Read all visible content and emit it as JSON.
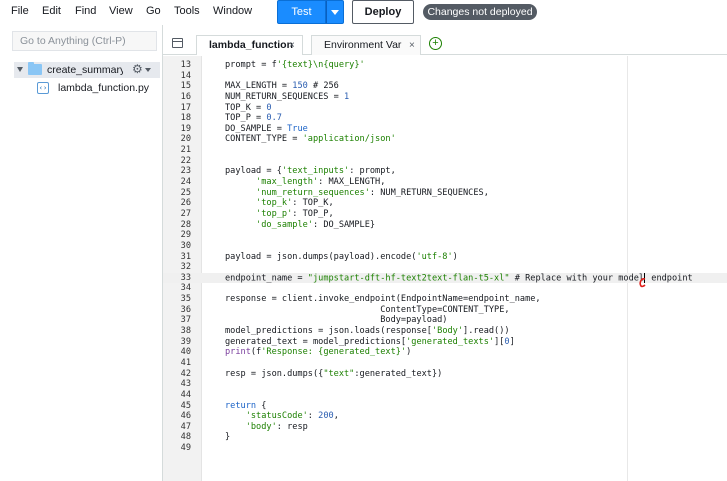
{
  "menubar": {
    "items": [
      "File",
      "Edit",
      "Find",
      "View",
      "Go",
      "Tools",
      "Window"
    ],
    "test_label": "Test",
    "deploy_label": "Deploy",
    "status_badge": "Changes not deployed"
  },
  "sidebar": {
    "goto_placeholder": "Go to Anything (Ctrl-P)",
    "folder_name": "create_summary_fu",
    "file_name": "lambda_function.py"
  },
  "tabs": [
    {
      "label": "lambda_function",
      "close": "×",
      "active": true
    },
    {
      "label": "Environment Var",
      "close": "×",
      "active": false
    }
  ],
  "icons": {
    "menu": "editor-menu-icon",
    "add_tab": "plus-circle-icon",
    "gear": "gear-icon",
    "folder": "folder-icon",
    "file": "python-file-icon"
  },
  "colors": {
    "accent": "#1a8cff",
    "keyword": "#1a62c7",
    "string": "#1d8102",
    "badge": "#545b64"
  },
  "code_lines": [
    {
      "n": "13",
      "segs": [
        [
          "",
          "prompt = f"
        ],
        [
          "st",
          "'{text}\\n{query}'"
        ]
      ]
    },
    {
      "n": "14",
      "segs": []
    },
    {
      "n": "15",
      "segs": [
        [
          "",
          "MAX_LENGTH = "
        ],
        [
          "nu",
          "150"
        ],
        [
          "",
          " # 256"
        ]
      ]
    },
    {
      "n": "16",
      "segs": [
        [
          "",
          "NUM_RETURN_SEQUENCES = "
        ],
        [
          "nu",
          "1"
        ]
      ]
    },
    {
      "n": "17",
      "segs": [
        [
          "",
          "TOP_K = "
        ],
        [
          "nu",
          "0"
        ]
      ]
    },
    {
      "n": "18",
      "segs": [
        [
          "",
          "TOP_P = "
        ],
        [
          "nu",
          "0.7"
        ]
      ]
    },
    {
      "n": "19",
      "segs": [
        [
          "",
          "DO_SAMPLE = "
        ],
        [
          "kw",
          "True"
        ]
      ]
    },
    {
      "n": "20",
      "segs": [
        [
          "",
          "CONTENT_TYPE = "
        ],
        [
          "st",
          "'application/json'"
        ]
      ]
    },
    {
      "n": "21",
      "segs": []
    },
    {
      "n": "22",
      "segs": []
    },
    {
      "n": "23",
      "segs": [
        [
          "",
          "payload = {"
        ],
        [
          "st",
          "'text_inputs'"
        ],
        [
          "",
          ": prompt,"
        ]
      ]
    },
    {
      "n": "24",
      "segs": [
        [
          "",
          "      "
        ],
        [
          "st",
          "'max_length'"
        ],
        [
          "",
          ": MAX_LENGTH,"
        ]
      ]
    },
    {
      "n": "25",
      "segs": [
        [
          "",
          "      "
        ],
        [
          "st",
          "'num_return_sequences'"
        ],
        [
          "",
          ": NUM_RETURN_SEQUENCES,"
        ]
      ]
    },
    {
      "n": "26",
      "segs": [
        [
          "",
          "      "
        ],
        [
          "st",
          "'top_k'"
        ],
        [
          "",
          ": TOP_K,"
        ]
      ]
    },
    {
      "n": "27",
      "segs": [
        [
          "",
          "      "
        ],
        [
          "st",
          "'top_p'"
        ],
        [
          "",
          ": TOP_P,"
        ]
      ]
    },
    {
      "n": "28",
      "segs": [
        [
          "",
          "      "
        ],
        [
          "st",
          "'do_sample'"
        ],
        [
          "",
          ": DO_SAMPLE}"
        ]
      ]
    },
    {
      "n": "29",
      "segs": []
    },
    {
      "n": "30",
      "segs": []
    },
    {
      "n": "31",
      "segs": [
        [
          "",
          "payload = json.dumps(payload).encode("
        ],
        [
          "st",
          "'utf-8'"
        ],
        [
          "",
          ")"
        ]
      ]
    },
    {
      "n": "32",
      "segs": []
    },
    {
      "n": "33",
      "segs": [
        [
          "",
          "endpoint_name = "
        ],
        [
          "st",
          "\"jumpstart-dft-hf-text2text-flan-t5-xl\""
        ],
        [
          "",
          " # Replace with your model"
        ],
        [
          "cursor",
          ""
        ],
        [
          "",
          " endpoint"
        ]
      ],
      "highlight": true
    },
    {
      "n": "34",
      "segs": []
    },
    {
      "n": "35",
      "segs": [
        [
          "",
          "response = client.invoke_endpoint(EndpointName=endpoint_name,"
        ]
      ]
    },
    {
      "n": "36",
      "segs": [
        [
          "",
          "                              ContentType=CONTENT_TYPE,"
        ]
      ]
    },
    {
      "n": "37",
      "segs": [
        [
          "",
          "                              Body=payload)"
        ]
      ]
    },
    {
      "n": "38",
      "segs": [
        [
          "",
          "model_predictions = json.loads(response["
        ],
        [
          "st",
          "'Body'"
        ],
        [
          "",
          "].read())"
        ]
      ]
    },
    {
      "n": "39",
      "segs": [
        [
          "",
          "generated_text = model_predictions["
        ],
        [
          "st",
          "'generated_texts'"
        ],
        [
          "",
          "]["
        ],
        [
          "nu",
          "0"
        ],
        [
          "",
          "]"
        ]
      ]
    },
    {
      "n": "40",
      "segs": [
        [
          "bi",
          "print"
        ],
        [
          "",
          "(f"
        ],
        [
          "st",
          "'Response: {generated_text}'"
        ],
        [
          "",
          ")"
        ]
      ]
    },
    {
      "n": "41",
      "segs": []
    },
    {
      "n": "42",
      "segs": [
        [
          "",
          "resp = json.dumps({"
        ],
        [
          "st",
          "\"text\""
        ],
        [
          "",
          ":generated_text})"
        ]
      ]
    },
    {
      "n": "43",
      "segs": []
    },
    {
      "n": "44",
      "segs": []
    },
    {
      "n": "45",
      "segs": [
        [
          "kw",
          "return"
        ],
        [
          "",
          " {"
        ]
      ]
    },
    {
      "n": "46",
      "segs": [
        [
          "",
          "    "
        ],
        [
          "st",
          "'statusCode'"
        ],
        [
          "",
          ": "
        ],
        [
          "nu",
          "200"
        ],
        [
          "",
          ","
        ]
      ]
    },
    {
      "n": "47",
      "segs": [
        [
          "",
          "    "
        ],
        [
          "st",
          "'body'"
        ],
        [
          "",
          ": resp"
        ]
      ]
    },
    {
      "n": "48",
      "segs": [
        [
          "",
          "}"
        ]
      ]
    },
    {
      "n": "49",
      "segs": []
    }
  ]
}
